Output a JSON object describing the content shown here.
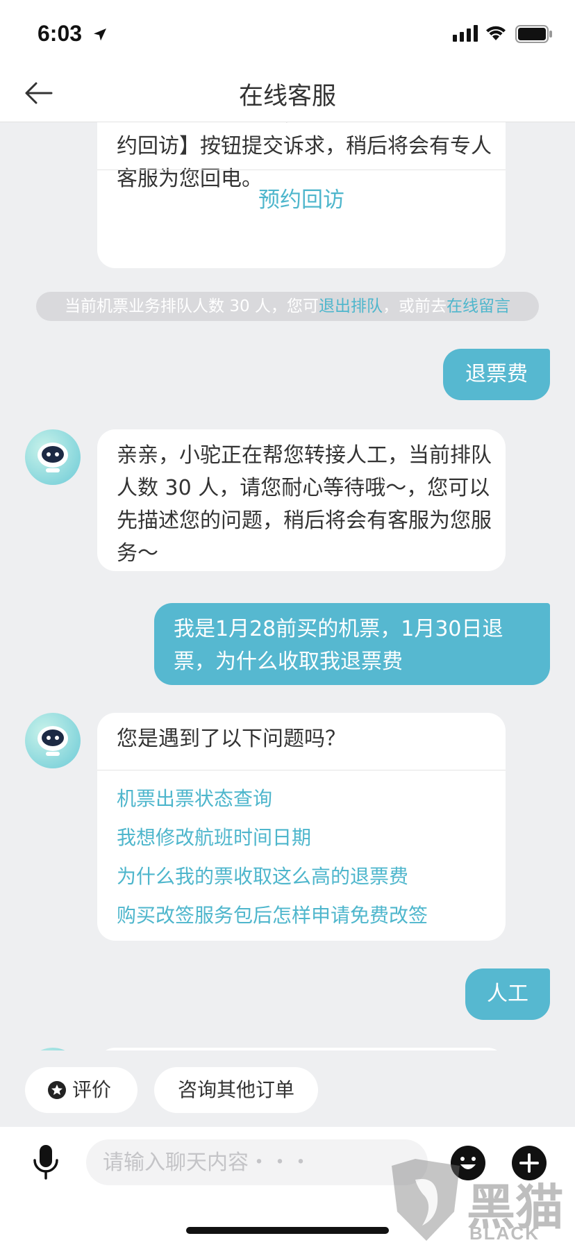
{
  "status_bar": {
    "time": "6:03"
  },
  "header": {
    "title": "在线客服"
  },
  "messages": {
    "top_card": {
      "text": "如您不想继续等待，您可以点击下方【预约回访】按钮提交诉求，稍后将会有专人客服为您回电。",
      "action": "预约回访"
    },
    "notice": {
      "prefix": "当前机票业务排队人数 30 人，您可",
      "link1": "退出排队",
      "middle": "，或前去",
      "link2": "在线留言"
    },
    "user1": "退票费",
    "bot1": "亲亲，小驼正在帮您转接人工，当前排队人数 30 人，请您耐心等待哦～，您可以先描述您的问题，稍后将会有客服为您服务～",
    "user2": "我是1月28前买的机票，1月30日退票，为什么收取我退票费",
    "bot2": {
      "question": "您是遇到了以下问题吗？",
      "options": [
        "机票出票状态查询",
        "我想修改航班时间日期",
        "为什么我的票收取这么高的退票费",
        "购买改签服务包后怎样申请免费改签"
      ]
    },
    "user3": "人工"
  },
  "quick_actions": {
    "rate": "评价",
    "other_orders": "咨询其他订单"
  },
  "input": {
    "placeholder": "请输入聊天内容・・・"
  },
  "watermark": {
    "cn": "黑猫",
    "en": "BLACK CAT"
  },
  "colors": {
    "accent": "#56b8d0",
    "link": "#4eb6cc",
    "background": "#eeeff1"
  },
  "icons": [
    "back-arrow-icon",
    "location-arrow-icon",
    "signal-icon",
    "wifi-icon",
    "battery-icon",
    "robot-avatar-icon",
    "star-icon",
    "microphone-icon",
    "emoji-icon",
    "plus-icon"
  ]
}
